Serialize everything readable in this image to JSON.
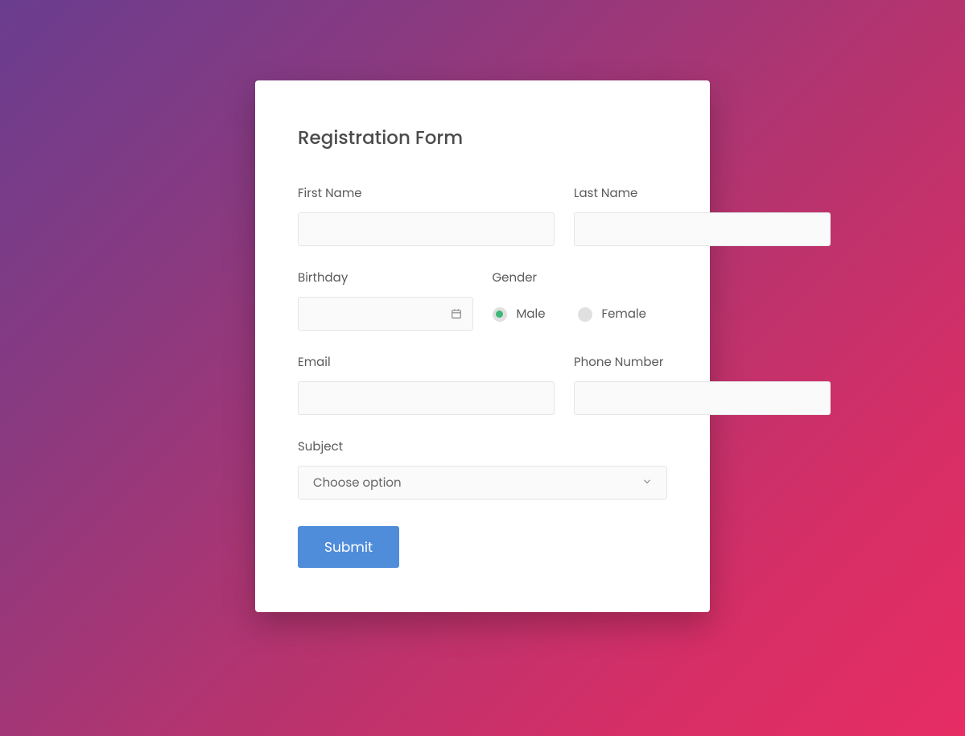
{
  "title": "Registration Form",
  "fields": {
    "firstName": {
      "label": "First Name",
      "value": ""
    },
    "lastName": {
      "label": "Last Name",
      "value": ""
    },
    "birthday": {
      "label": "Birthday",
      "value": ""
    },
    "gender": {
      "label": "Gender",
      "options": {
        "male": "Male",
        "female": "Female"
      },
      "selected": "male"
    },
    "email": {
      "label": "Email",
      "value": ""
    },
    "phone": {
      "label": "Phone Number",
      "value": ""
    },
    "subject": {
      "label": "Subject",
      "placeholder": "Choose option"
    }
  },
  "submit": "Submit"
}
